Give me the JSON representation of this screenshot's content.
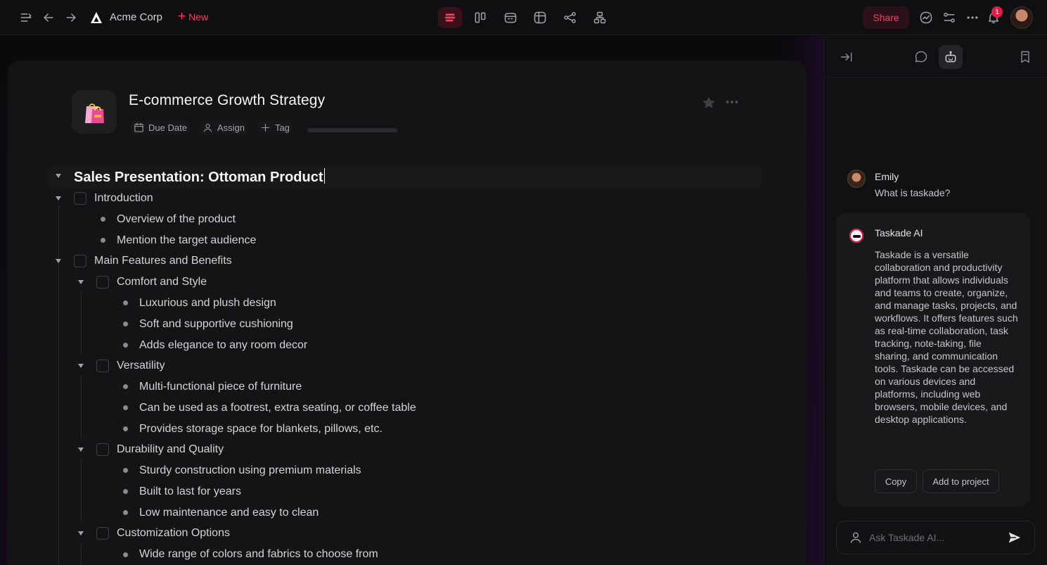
{
  "topbar": {
    "workspace_name": "Acme Corp",
    "new_label": "New",
    "share_label": "Share",
    "notification_count": "1",
    "accent_color": "#f43f5e"
  },
  "project": {
    "title": "E-commerce Growth Strategy",
    "icon": "shopping-bags-icon",
    "meta": {
      "due_date": "Due Date",
      "assign": "Assign",
      "tag": "Tag"
    }
  },
  "outline": {
    "heading": "Sales Presentation: Ottoman Product",
    "items": [
      {
        "text": "Introduction"
      },
      {
        "text": "Overview of the product"
      },
      {
        "text": "Mention the target audience"
      },
      {
        "text": "Main Features and Benefits"
      },
      {
        "text": "Comfort and Style"
      },
      {
        "text": "Luxurious and plush design"
      },
      {
        "text": "Soft and supportive cushioning"
      },
      {
        "text": "Adds elegance to any room decor"
      },
      {
        "text": "Versatility"
      },
      {
        "text": "Multi-functional piece of furniture"
      },
      {
        "text": "Can be used as a footrest, extra seating, or coffee table"
      },
      {
        "text": "Provides storage space for blankets, pillows, etc."
      },
      {
        "text": "Durability and Quality"
      },
      {
        "text": "Sturdy construction using premium materials"
      },
      {
        "text": "Built to last for years"
      },
      {
        "text": "Low maintenance and easy to clean"
      },
      {
        "text": "Customization Options"
      },
      {
        "text": "Wide range of colors and fabrics to choose from"
      }
    ]
  },
  "chat": {
    "user_name": "Emily",
    "user_message": "What is taskade?",
    "ai_name": "Taskade AI",
    "ai_message": "Taskade is a versatile collaboration and productivity platform that allows individuals and teams to create, organize, and manage tasks, projects, and workflows. It offers features such as real-time collaboration, task tracking, note-taking, file sharing, and communication tools. Taskade can be accessed on various devices and platforms, including web browsers, mobile devices, and desktop applications.",
    "copy_label": "Copy",
    "add_label": "Add to project",
    "input_placeholder": "Ask Taskade AI..."
  }
}
